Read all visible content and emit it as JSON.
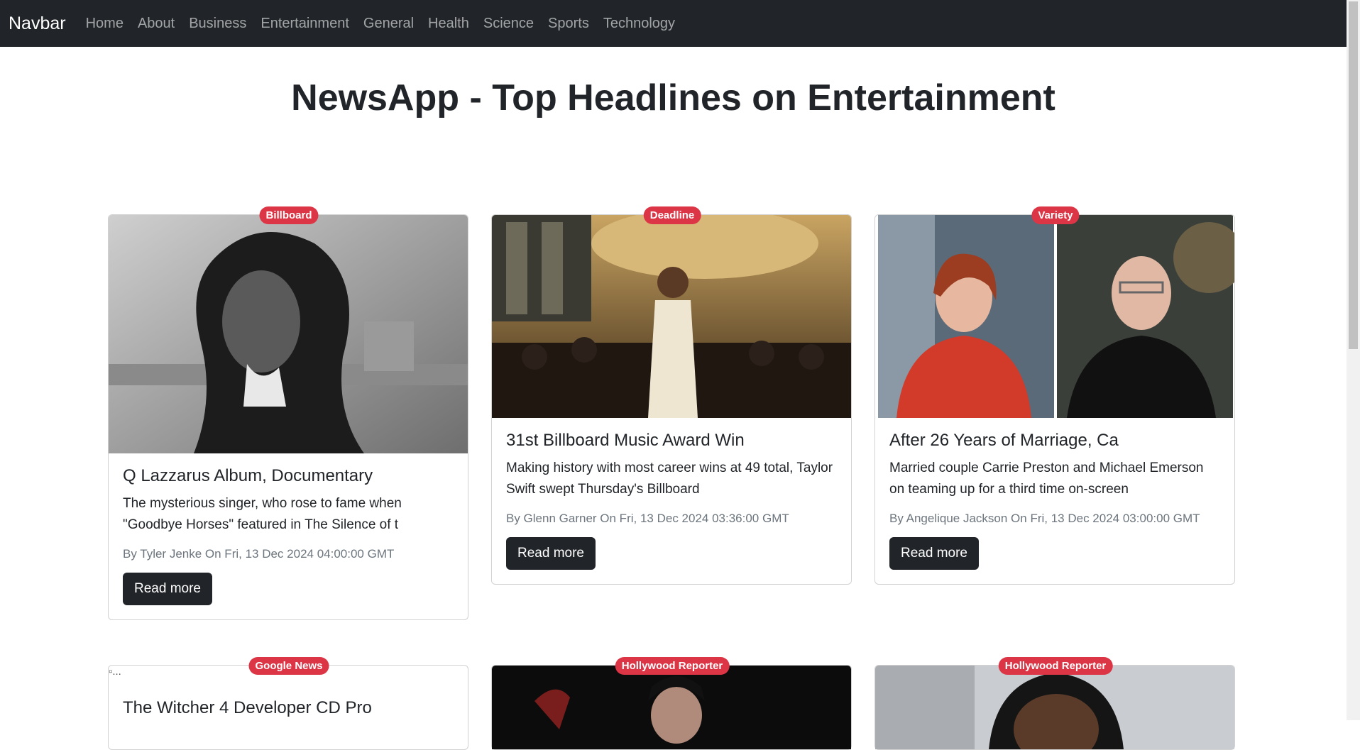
{
  "navbar": {
    "brand": "Navbar",
    "links": [
      "Home",
      "About",
      "Business",
      "Entertainment",
      "General",
      "Health",
      "Science",
      "Sports",
      "Technology"
    ]
  },
  "page": {
    "title": "NewsApp - Top Headlines on Entertainment"
  },
  "colors": {
    "navbar_bg": "#212529",
    "badge_bg": "#dc3545",
    "button_bg": "#212529"
  },
  "cards": [
    {
      "source": "Billboard",
      "title": "Q Lazzarus Album, Documentary",
      "description": "The mysterious singer, who rose to fame when \"Goodbye Horses\" featured in The Silence of t",
      "meta": "By Tyler Jenke On Fri, 13 Dec 2024 04:00:00 GMT",
      "button": "Read more"
    },
    {
      "source": "Deadline",
      "title": "31st Billboard Music Award Win",
      "description": "Making history with most career wins at 49 total, Taylor Swift swept Thursday's Billboard",
      "meta": "By Glenn Garner On Fri, 13 Dec 2024 03:36:00 GMT",
      "button": "Read more"
    },
    {
      "source": "Variety",
      "title": "After 26 Years of Marriage, Ca",
      "description": "Married couple Carrie Preston and Michael Emerson on teaming up for a third time on-screen",
      "meta": "By Angelique Jackson On Fri, 13 Dec 2024 03:00:00 GMT",
      "button": "Read more"
    },
    {
      "source": "Google News",
      "image_alt": "...",
      "title": "The Witcher 4 Developer CD Pro"
    },
    {
      "source": "Hollywood Reporter"
    },
    {
      "source": "Hollywood Reporter"
    }
  ]
}
